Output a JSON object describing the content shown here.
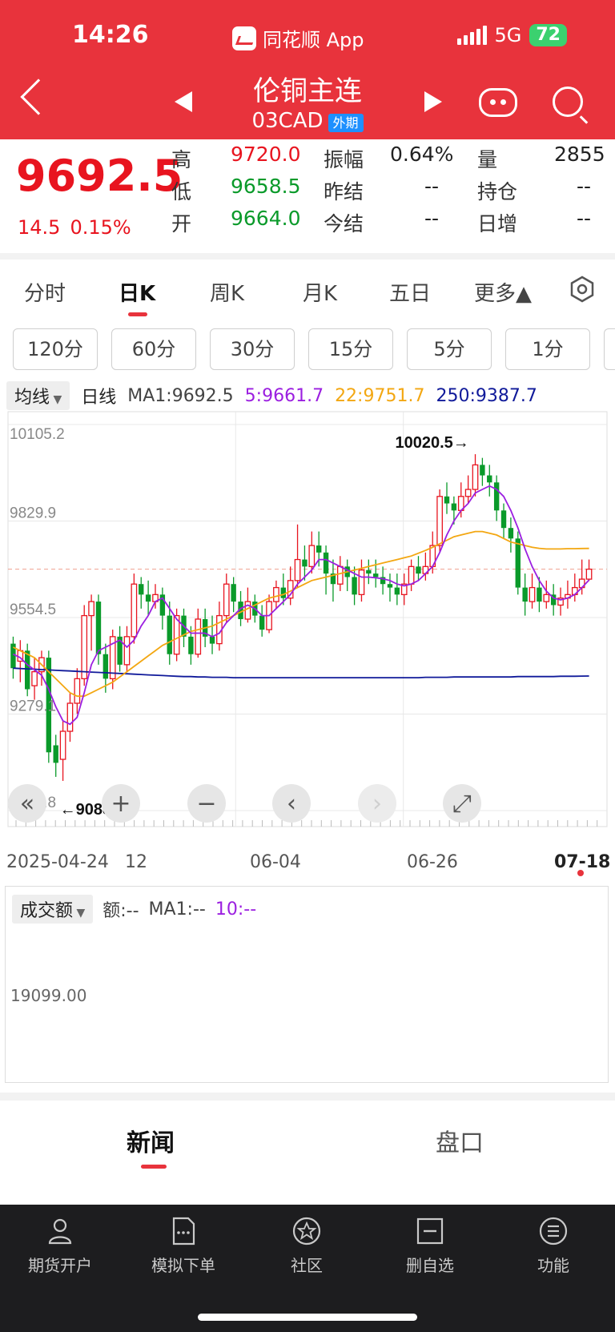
{
  "status": {
    "time": "14:26",
    "app": "同花顺 App",
    "network": "5G",
    "battery": "72"
  },
  "header": {
    "title": "伦铜主连",
    "code": "03CAD",
    "tag": "外期"
  },
  "quote": {
    "price": "9692.5",
    "change": "14.5",
    "change_pct": "0.15%",
    "high_label": "高",
    "high": "9720.0",
    "low_label": "低",
    "low": "9658.5",
    "open_label": "开",
    "open": "9664.0",
    "amp_label": "振幅",
    "amp": "0.64%",
    "prev_settle_label": "昨结",
    "prev_settle": "--",
    "settle_label": "今结",
    "settle": "--",
    "vol_label": "量",
    "vol": "2855",
    "oi_label": "持仓",
    "oi": "--",
    "daily_inc_label": "日增",
    "daily_inc": "--"
  },
  "tabs": [
    "分时",
    "日K",
    "周K",
    "月K",
    "五日",
    "更多▲"
  ],
  "periods": [
    "120分",
    "60分",
    "30分",
    "15分",
    "5分",
    "1分"
  ],
  "ma_legend": {
    "select": "均线",
    "type": "日线",
    "ma1": "MA1:9692.5",
    "ma5": "5:9661.7",
    "ma22": "22:9751.7",
    "ma250": "250:9387.7"
  },
  "colors": {
    "red": "#e8141f",
    "green": "#0a9a2a",
    "ma5": "#9b1fe0",
    "ma22": "#f3a712",
    "ma250": "#101a9a"
  },
  "chart_data": {
    "type": "candlestick",
    "y_ticks": [
      "10105.2",
      "9829.9",
      "9554.5",
      "9279.1",
      "9003.8"
    ],
    "ylim": [
      9003.8,
      10105.2
    ],
    "high_annotation": "10020.5→",
    "low_annotation": "←9088.5",
    "x_ticks": [
      "2025-04-24",
      "12",
      "06-04",
      "06-26",
      "07-18"
    ],
    "candles": [
      [
        9480,
        9410,
        9500,
        9380
      ],
      [
        9430,
        9460,
        9490,
        9370
      ],
      [
        9460,
        9350,
        9480,
        9330
      ],
      [
        9360,
        9400,
        9440,
        9320
      ],
      [
        9400,
        9440,
        9460,
        9360
      ],
      [
        9440,
        9170,
        9460,
        9140
      ],
      [
        9190,
        9140,
        9220,
        9100
      ],
      [
        9150,
        9230,
        9260,
        9088.5
      ],
      [
        9230,
        9310,
        9340,
        9200
      ],
      [
        9310,
        9380,
        9410,
        9280
      ],
      [
        9380,
        9560,
        9590,
        9360
      ],
      [
        9560,
        9600,
        9620,
        9460
      ],
      [
        9600,
        9450,
        9620,
        9420
      ],
      [
        9450,
        9380,
        9480,
        9340
      ],
      [
        9380,
        9500,
        9520,
        9350
      ],
      [
        9500,
        9420,
        9530,
        9400
      ],
      [
        9420,
        9500,
        9530,
        9400
      ],
      [
        9500,
        9650,
        9680,
        9480
      ],
      [
        9650,
        9620,
        9670,
        9580
      ],
      [
        9620,
        9600,
        9660,
        9560
      ],
      [
        9600,
        9620,
        9650,
        9580
      ],
      [
        9620,
        9560,
        9640,
        9520
      ],
      [
        9560,
        9450,
        9600,
        9420
      ],
      [
        9450,
        9560,
        9580,
        9430
      ],
      [
        9560,
        9500,
        9580,
        9470
      ],
      [
        9500,
        9450,
        9530,
        9420
      ],
      [
        9450,
        9550,
        9580,
        9440
      ],
      [
        9550,
        9500,
        9580,
        9470
      ],
      [
        9500,
        9480,
        9560,
        9450
      ],
      [
        9480,
        9560,
        9600,
        9460
      ],
      [
        9560,
        9650,
        9680,
        9540
      ],
      [
        9650,
        9600,
        9670,
        9570
      ],
      [
        9600,
        9550,
        9630,
        9530
      ],
      [
        9550,
        9600,
        9640,
        9540
      ],
      [
        9600,
        9560,
        9620,
        9540
      ],
      [
        9560,
        9520,
        9590,
        9500
      ],
      [
        9520,
        9600,
        9620,
        9510
      ],
      [
        9600,
        9640,
        9660,
        9580
      ],
      [
        9640,
        9610,
        9680,
        9590
      ],
      [
        9610,
        9660,
        9700,
        9590
      ],
      [
        9660,
        9720,
        9820,
        9640
      ],
      [
        9720,
        9700,
        9760,
        9660
      ],
      [
        9700,
        9760,
        9800,
        9680
      ],
      [
        9760,
        9740,
        9800,
        9700
      ],
      [
        9740,
        9680,
        9760,
        9620
      ],
      [
        9680,
        9650,
        9720,
        9600
      ],
      [
        9650,
        9700,
        9730,
        9630
      ],
      [
        9700,
        9670,
        9720,
        9630
      ],
      [
        9670,
        9620,
        9700,
        9590
      ],
      [
        9620,
        9690,
        9720,
        9600
      ],
      [
        9690,
        9680,
        9720,
        9650
      ],
      [
        9680,
        9670,
        9720,
        9640
      ],
      [
        9670,
        9650,
        9700,
        9620
      ],
      [
        9650,
        9640,
        9680,
        9600
      ],
      [
        9640,
        9620,
        9680,
        9590
      ],
      [
        9620,
        9650,
        9680,
        9590
      ],
      [
        9650,
        9700,
        9720,
        9630
      ],
      [
        9700,
        9680,
        9730,
        9660
      ],
      [
        9680,
        9700,
        9740,
        9660
      ],
      [
        9700,
        9760,
        9800,
        9680
      ],
      [
        9760,
        9900,
        9920,
        9740
      ],
      [
        9900,
        9880,
        9940,
        9850
      ],
      [
        9880,
        9860,
        9900,
        9820
      ],
      [
        9860,
        9900,
        9940,
        9840
      ],
      [
        9900,
        9920,
        9960,
        9880
      ],
      [
        9920,
        9990,
        10020.5,
        9900
      ],
      [
        9990,
        9960,
        10010,
        9930
      ],
      [
        9960,
        9940,
        9990,
        9900
      ],
      [
        9940,
        9860,
        9960,
        9830
      ],
      [
        9860,
        9810,
        9880,
        9780
      ],
      [
        9810,
        9780,
        9840,
        9740
      ],
      [
        9780,
        9640,
        9800,
        9620
      ],
      [
        9640,
        9600,
        9680,
        9560
      ],
      [
        9600,
        9640,
        9680,
        9580
      ],
      [
        9640,
        9600,
        9670,
        9570
      ],
      [
        9600,
        9620,
        9660,
        9580
      ],
      [
        9620,
        9590,
        9650,
        9560
      ],
      [
        9590,
        9610,
        9640,
        9560
      ],
      [
        9610,
        9620,
        9660,
        9580
      ],
      [
        9620,
        9640,
        9680,
        9600
      ],
      [
        9640,
        9664,
        9720,
        9620
      ],
      [
        9664,
        9692.5,
        9720,
        9658.5
      ]
    ],
    "ma5": [
      9450,
      9440,
      9420,
      9405,
      9390,
      9350,
      9300,
      9260,
      9250,
      9270,
      9340,
      9420,
      9460,
      9470,
      9480,
      9490,
      9470,
      9490,
      9530,
      9560,
      9600,
      9610,
      9580,
      9550,
      9530,
      9510,
      9510,
      9510,
      9500,
      9510,
      9540,
      9560,
      9580,
      9590,
      9580,
      9560,
      9560,
      9580,
      9600,
      9620,
      9650,
      9670,
      9690,
      9720,
      9720,
      9710,
      9700,
      9690,
      9680,
      9670,
      9670,
      9668,
      9665,
      9660,
      9650,
      9645,
      9650,
      9660,
      9680,
      9700,
      9740,
      9790,
      9830,
      9860,
      9880,
      9910,
      9920,
      9930,
      9920,
      9900,
      9860,
      9810,
      9750,
      9700,
      9660,
      9630,
      9610,
      9605,
      9610,
      9620,
      9640,
      9661.7
    ],
    "ma22": [
      9470,
      9460,
      9450,
      9440,
      9420,
      9400,
      9380,
      9360,
      9340,
      9330,
      9330,
      9340,
      9350,
      9360,
      9370,
      9385,
      9400,
      9415,
      9430,
      9445,
      9460,
      9475,
      9485,
      9495,
      9505,
      9515,
      9520,
      9525,
      9530,
      9540,
      9550,
      9560,
      9570,
      9580,
      9590,
      9600,
      9610,
      9615,
      9620,
      9630,
      9640,
      9650,
      9660,
      9665,
      9670,
      9675,
      9680,
      9685,
      9690,
      9695,
      9700,
      9705,
      9710,
      9715,
      9720,
      9725,
      9730,
      9738,
      9746,
      9755,
      9765,
      9775,
      9785,
      9790,
      9795,
      9800,
      9800,
      9795,
      9790,
      9780,
      9770,
      9765,
      9760,
      9755,
      9752,
      9750,
      9750,
      9750,
      9751,
      9751,
      9751.5,
      9751.7
    ],
    "ma250": [
      9410,
      9409,
      9408,
      9407,
      9406,
      9405,
      9404,
      9403,
      9402,
      9401,
      9400,
      9399,
      9398,
      9397,
      9396,
      9395,
      9394,
      9393,
      9392,
      9391,
      9390,
      9389,
      9388,
      9387,
      9386,
      9386,
      9385,
      9385,
      9384,
      9384,
      9384,
      9383,
      9383,
      9383,
      9383,
      9383,
      9383,
      9383,
      9383,
      9383,
      9383,
      9383,
      9383,
      9383,
      9383,
      9383,
      9383,
      9383,
      9383,
      9383,
      9383,
      9383,
      9383,
      9383,
      9383,
      9383,
      9383,
      9383,
      9384,
      9384,
      9384,
      9384,
      9385,
      9385,
      9385,
      9385,
      9385,
      9385,
      9385,
      9385,
      9385,
      9386,
      9386,
      9386,
      9386,
      9386,
      9386,
      9387,
      9387,
      9387,
      9387.5,
      9387.7
    ]
  },
  "volume": {
    "select": "成交额",
    "amount": "额:--",
    "ma1": "MA1:--",
    "ma10": "10:--",
    "tick": "19099.00"
  },
  "news_tabs": [
    "新闻",
    "盘口"
  ],
  "bottom_nav": [
    "期货开户",
    "模拟下单",
    "社区",
    "删自选",
    "功能"
  ]
}
